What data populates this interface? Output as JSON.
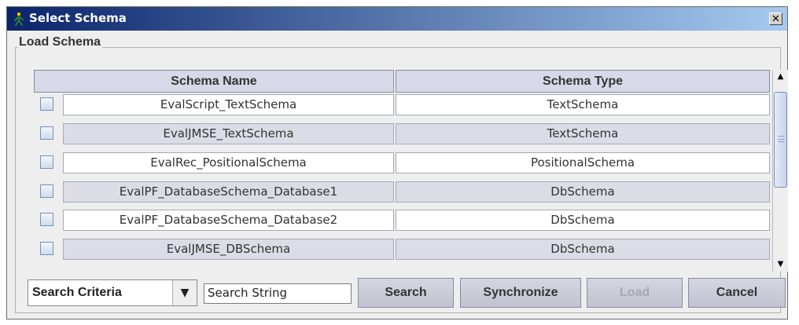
{
  "window": {
    "title": "Select Schema",
    "close_glyph": "✕"
  },
  "group": {
    "label": "Load Schema"
  },
  "table": {
    "columns": [
      "Schema Name",
      "Schema Type"
    ],
    "rows": [
      {
        "name": "EvalScript_TextSchema",
        "type": "TextSchema"
      },
      {
        "name": "EvalJMSE_TextSchema",
        "type": "TextSchema"
      },
      {
        "name": "EvalRec_PositionalSchema",
        "type": "PositionalSchema"
      },
      {
        "name": "EvalPF_DatabaseSchema_Database1",
        "type": "DbSchema"
      },
      {
        "name": "EvalPF_DatabaseSchema_Database2",
        "type": "DbSchema"
      },
      {
        "name": "EvalJMSE_DBSchema",
        "type": "DbSchema"
      }
    ]
  },
  "bottom": {
    "criteria_value": "Search Criteria",
    "search_value": "Search String",
    "search_label": "Search",
    "sync_label": "Synchronize",
    "load_label": "Load",
    "cancel_label": "Cancel"
  },
  "icons": {
    "app": "app-person-icon",
    "close": "close-icon",
    "dropdown": "chevron-down-icon",
    "scroll_up": "scroll-up-arrow-icon",
    "scroll_down": "scroll-down-arrow-icon"
  }
}
